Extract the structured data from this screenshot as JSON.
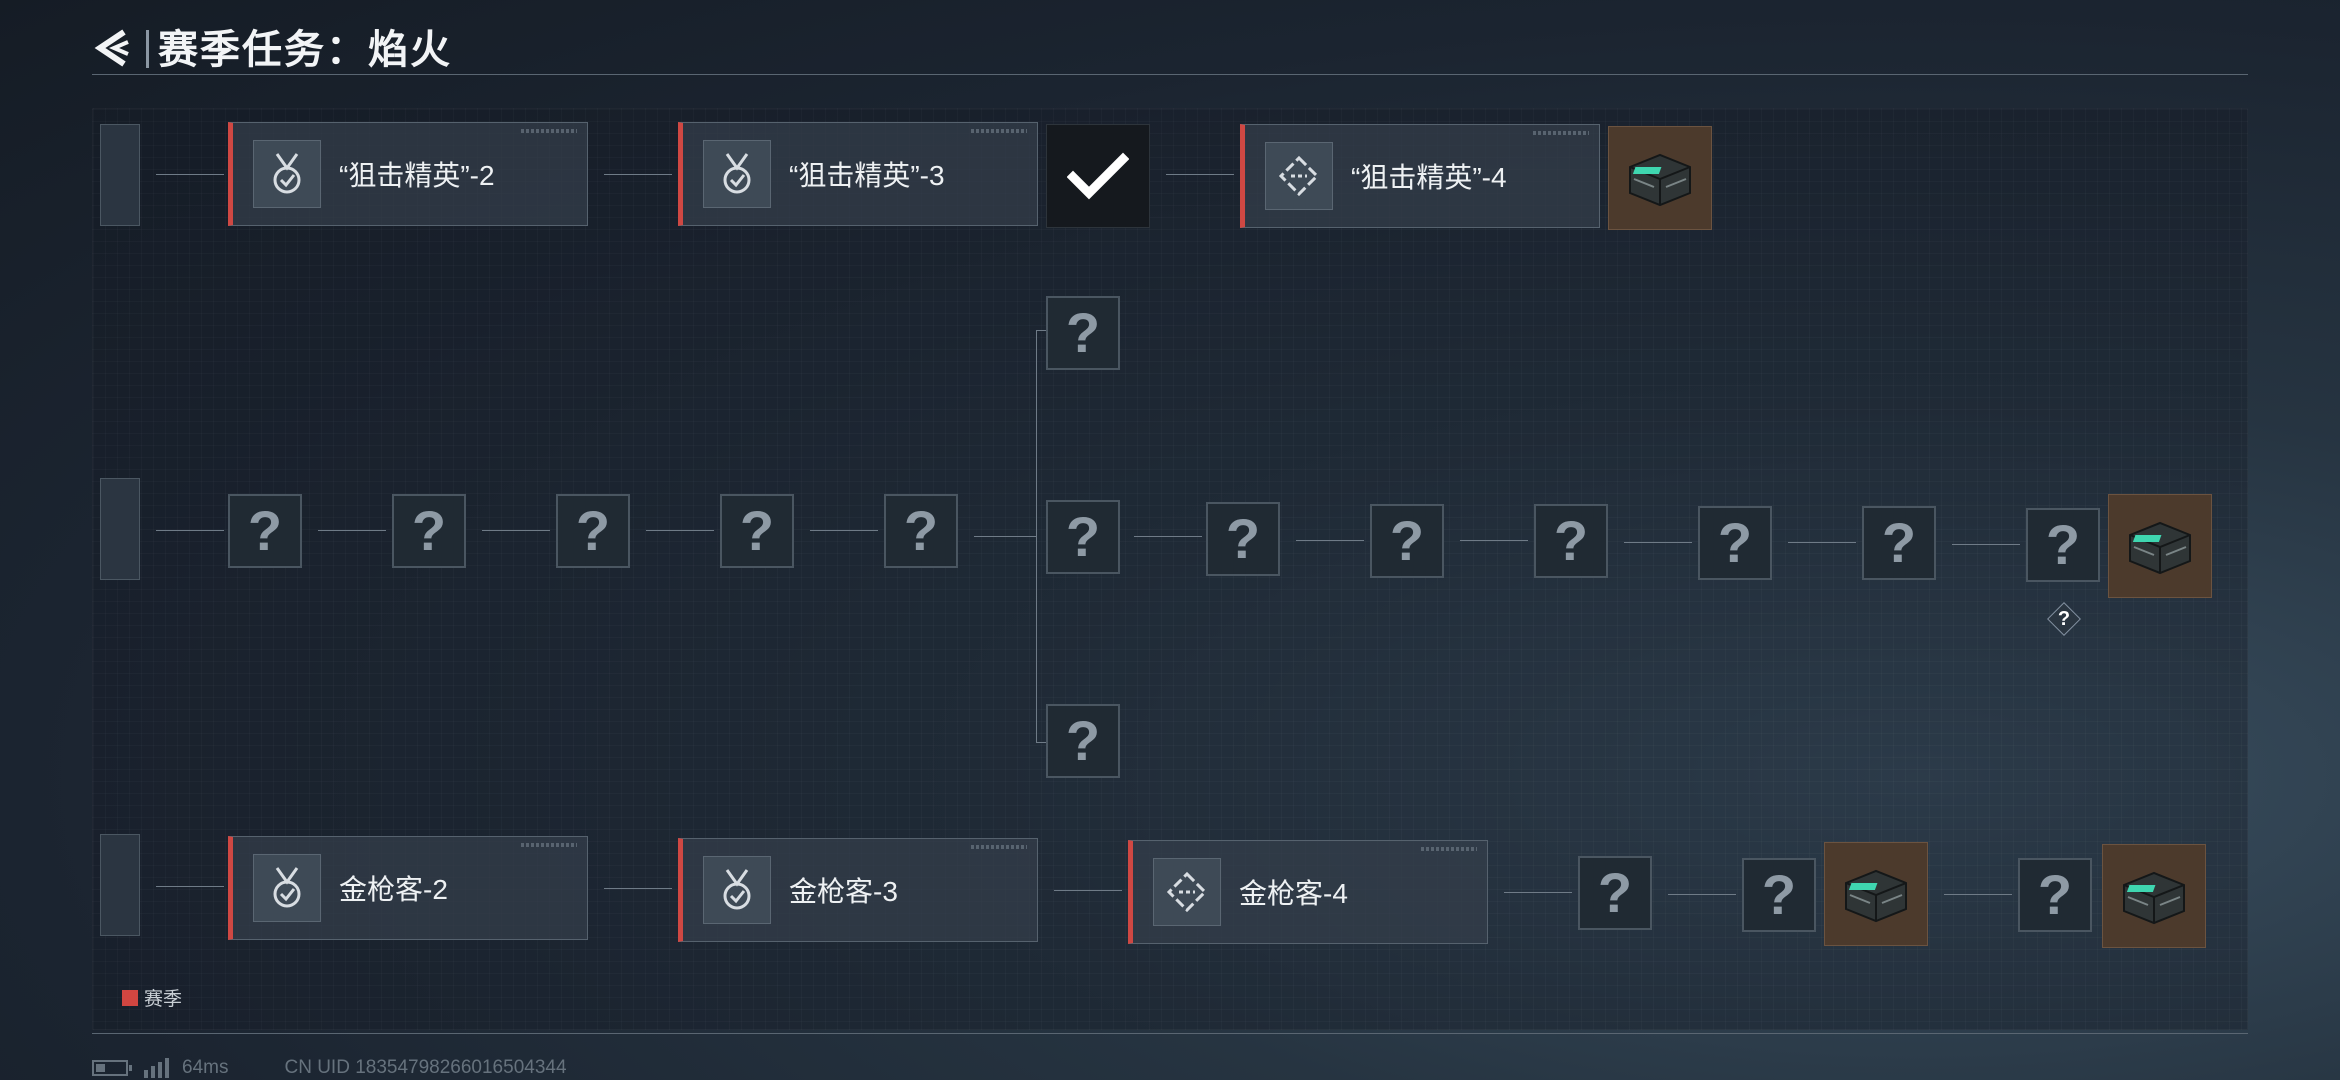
{
  "header": {
    "title": "赛季任务：焰火",
    "back_icon": "chevron-left-icon"
  },
  "rows": {
    "top": {
      "tasks": [
        {
          "label": "“狙击精英”-2",
          "icon": "medal-check-icon"
        },
        {
          "label": "“狙击精英”-3",
          "icon": "medal-check-icon"
        },
        {
          "label": "“狙击精英”-4",
          "icon": "diamond-dash-icon"
        }
      ],
      "completed_marker": "check-icon",
      "reward": "supply-crate-icon"
    },
    "middle": {
      "unknown_glyph": "?",
      "unknown_count_before_branch": 5,
      "branch_nodes": 3,
      "unknown_count_after_branch": 6,
      "reward": "supply-crate-icon",
      "hint_marker": "?"
    },
    "bottom": {
      "tasks": [
        {
          "label": "金枪客-2",
          "icon": "medal-check-icon"
        },
        {
          "label": "金枪客-3",
          "icon": "medal-check-icon"
        },
        {
          "label": "金枪客-4",
          "icon": "diamond-dash-icon"
        }
      ],
      "unknown_glyph": "?",
      "rewards": [
        "supply-crate-icon",
        "supply-crate-icon"
      ]
    }
  },
  "legend": {
    "label": "赛季",
    "color": "#d14641"
  },
  "status_bar": {
    "ping": "64ms",
    "uid": "CN UID 18354798266016504344"
  },
  "colors": {
    "accent": "#cf4843",
    "reward_bg": "#4c3a2c"
  }
}
